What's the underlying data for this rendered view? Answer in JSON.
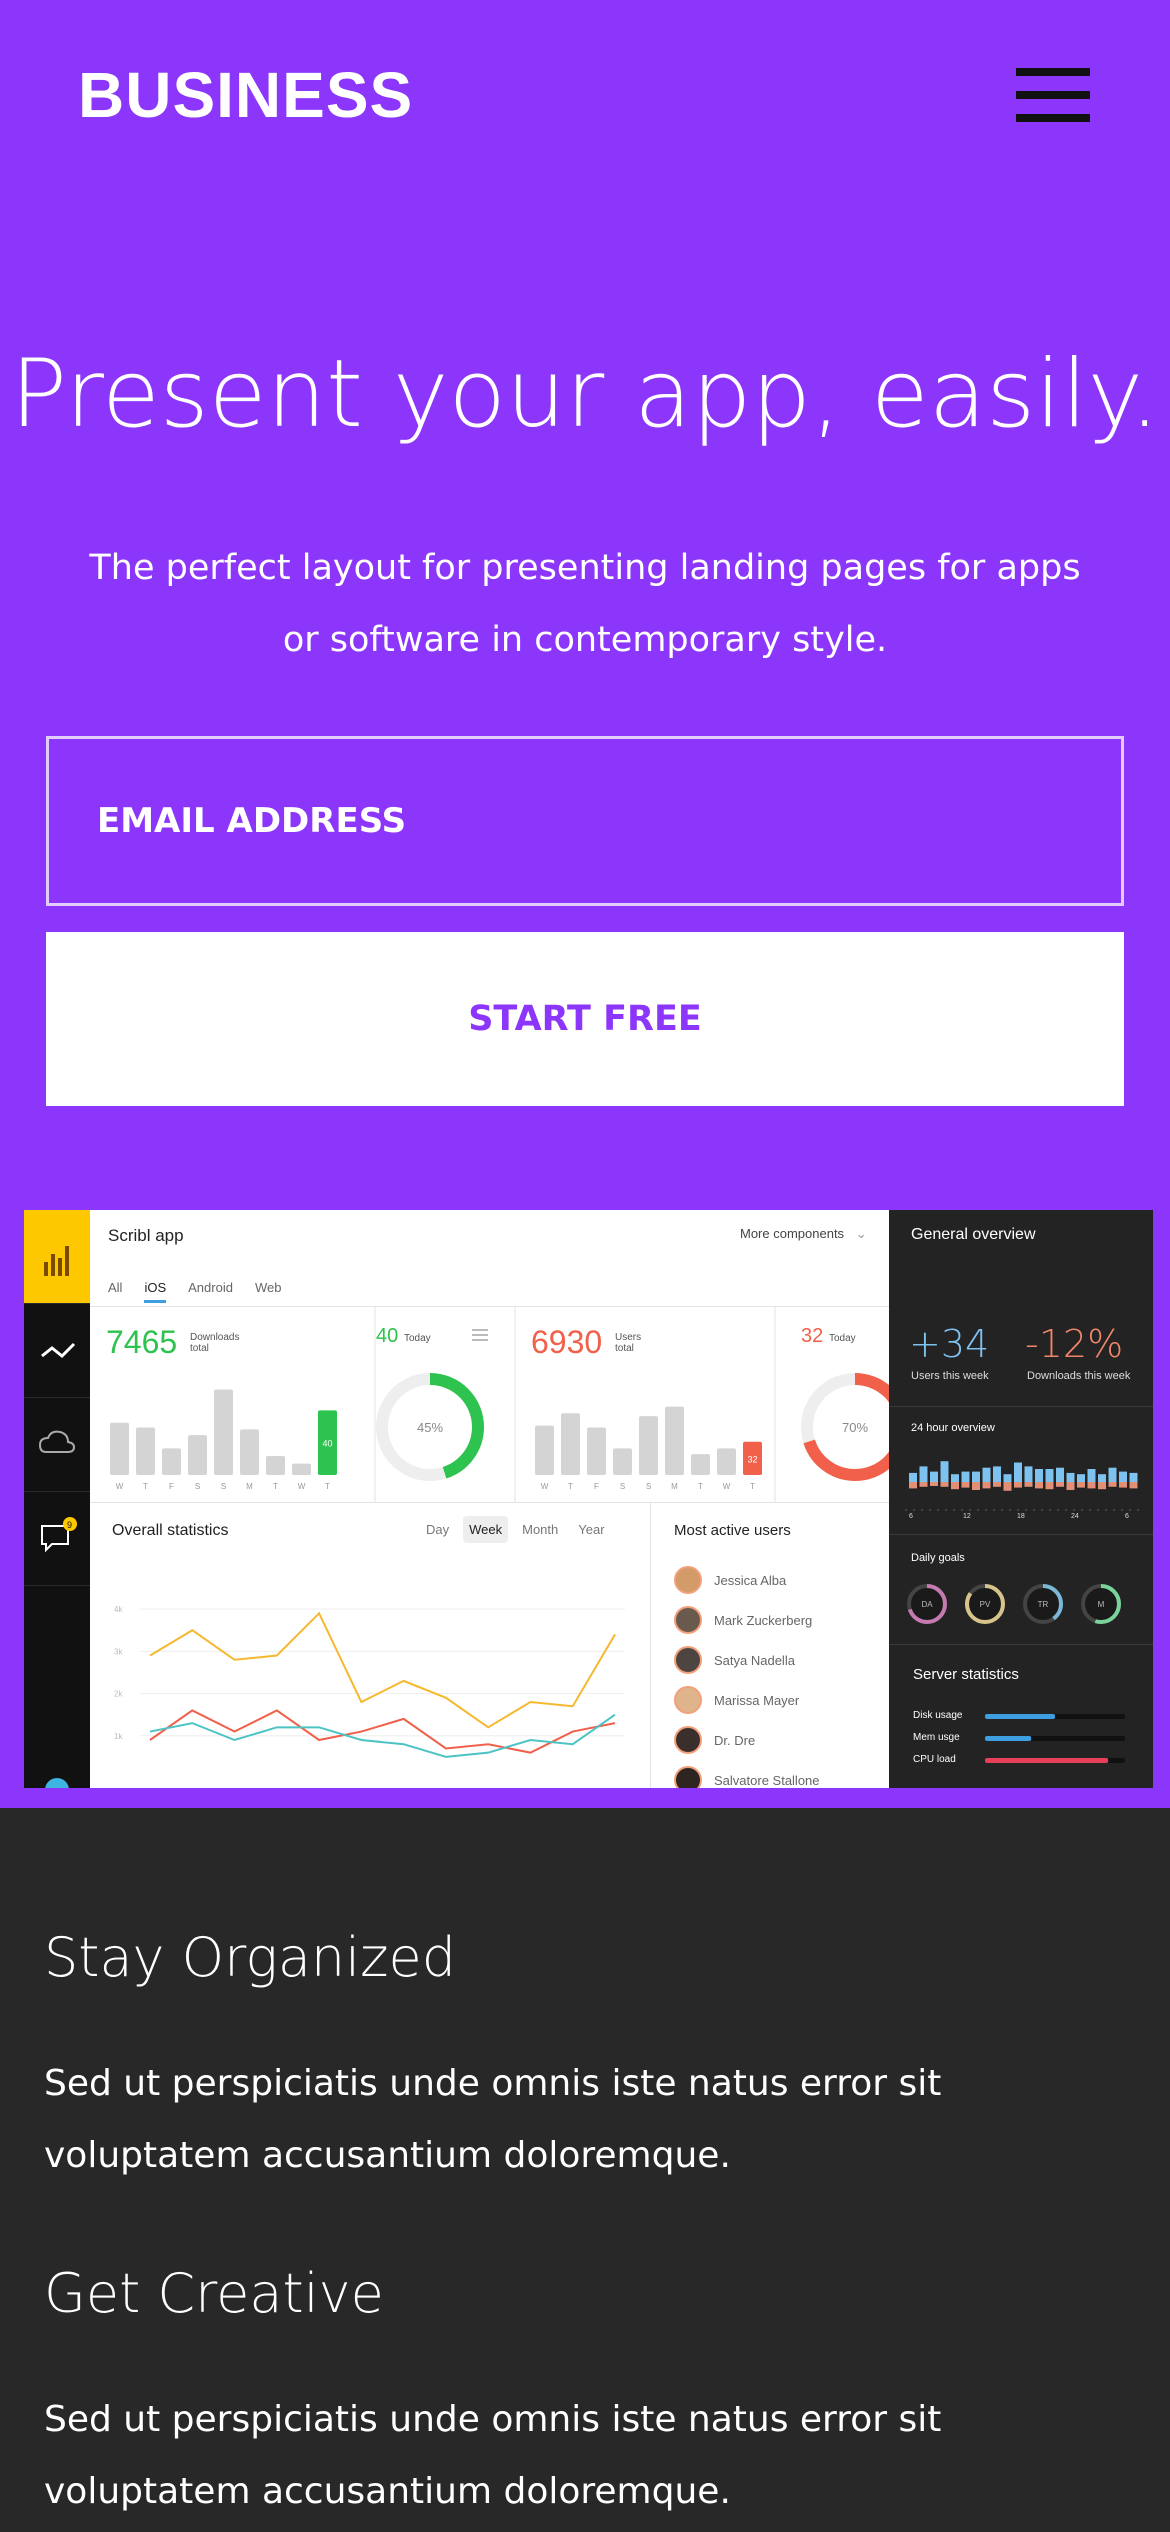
{
  "header": {
    "logo": "BUSINESS",
    "menu_icon": "hamburger-icon"
  },
  "hero": {
    "headline": "Present your app, easily.",
    "subtext": "The perfect layout for presenting landing pages for apps or software in contemporary style.",
    "email_placeholder": "EMAIL ADDRESS",
    "cta_label": "START FREE"
  },
  "colors": {
    "brand": "#8c36fb",
    "dark_section": "#282828",
    "accent_green": "#2ec24e",
    "accent_red": "#f0604a",
    "accent_yellow": "#f5b82e",
    "accent_teal": "#4cc3c4"
  },
  "dashboard": {
    "app_title": "Scribl app",
    "more_components": "More components",
    "platform_tabs": [
      "All",
      "iOS",
      "Android",
      "Web"
    ],
    "active_tab": "iOS",
    "downloads": {
      "total": "7465",
      "label1": "Downloads",
      "label2": "total",
      "today": "40",
      "today_label": "Today",
      "percent": 45,
      "percent_label": "45%"
    },
    "users": {
      "total": "6930",
      "label1": "Users",
      "label2": "total",
      "today": "32",
      "today_label": "Today",
      "percent": 70,
      "percent_label": "70%"
    },
    "weekday_labels": [
      "W",
      "T",
      "F",
      "S",
      "S",
      "M",
      "T",
      "W",
      "T"
    ],
    "downloads_bars": [
      0.55,
      0.5,
      0.28,
      0.42,
      0.9,
      0.48,
      0.2,
      0.12,
      0.68
    ],
    "users_bars": [
      0.52,
      0.65,
      0.5,
      0.28,
      0.62,
      0.72,
      0.22,
      0.28,
      0.35
    ],
    "overall_statistics": {
      "title": "Overall statistics",
      "ranges": [
        "Day",
        "Week",
        "Month",
        "Year"
      ],
      "active_range": "Week",
      "y_ticks": [
        "4k",
        "3k",
        "2k",
        "1k"
      ],
      "series": [
        {
          "color": "#f5b82e",
          "values": [
            2.9,
            3.5,
            2.8,
            2.9,
            3.9,
            1.8,
            2.3,
            1.9,
            1.2,
            1.8,
            1.7,
            3.4
          ]
        },
        {
          "color": "#f0604a",
          "values": [
            0.9,
            1.6,
            1.1,
            1.6,
            0.9,
            1.1,
            1.4,
            0.7,
            0.8,
            0.6,
            1.1,
            1.3
          ]
        },
        {
          "color": "#4cc3c4",
          "values": [
            1.1,
            1.3,
            0.9,
            1.2,
            1.2,
            0.9,
            0.8,
            0.5,
            0.6,
            0.9,
            0.8,
            1.5
          ]
        }
      ]
    },
    "most_active_users": {
      "title": "Most active users",
      "users": [
        {
          "name": "Jessica Alba",
          "color": "#d39a6a"
        },
        {
          "name": "Mark Zuckerberg",
          "color": "#6a5a4e"
        },
        {
          "name": "Satya Nadella",
          "color": "#4e4540"
        },
        {
          "name": "Marissa Mayer",
          "color": "#e0b48a"
        },
        {
          "name": "Dr. Dre",
          "color": "#3a2f2a"
        },
        {
          "name": "Salvatore Stallone",
          "color": "#2e2420"
        }
      ]
    },
    "general_overview": {
      "title": "General overview",
      "users_value": "+34",
      "users_label": "Users this week",
      "downloads_value": "-12%",
      "downloads_label": "Downloads this week",
      "hour_title": "24 hour overview",
      "hour_ticks": [
        "6",
        "12",
        "18",
        "24",
        "6"
      ],
      "hour_up": [
        0.35,
        0.6,
        0.4,
        0.8,
        0.3,
        0.4,
        0.4,
        0.55,
        0.6,
        0.3,
        0.75,
        0.6,
        0.5,
        0.5,
        0.55,
        0.35,
        0.3,
        0.5,
        0.3,
        0.55,
        0.4,
        0.35
      ],
      "hour_down": [
        0.4,
        0.3,
        0.25,
        0.3,
        0.45,
        0.35,
        0.5,
        0.4,
        0.3,
        0.55,
        0.35,
        0.3,
        0.4,
        0.45,
        0.3,
        0.5,
        0.35,
        0.4,
        0.45,
        0.3,
        0.35,
        0.4
      ],
      "goals_title": "Daily goals",
      "goals": [
        {
          "label": "DA",
          "color": "#c77ab0",
          "value": 0.7
        },
        {
          "label": "PV",
          "color": "#d7c48a",
          "value": 0.85
        },
        {
          "label": "TR",
          "color": "#7bb8d8",
          "value": 0.4
        },
        {
          "label": "M",
          "color": "#7ad49a",
          "value": 0.55
        }
      ],
      "server_title": "Server statistics",
      "server": [
        {
          "label": "Disk usage",
          "color": "#3d9fe0",
          "value": 0.5
        },
        {
          "label": "Mem usge",
          "color": "#3d9fe0",
          "value": 0.33
        },
        {
          "label": "CPU load",
          "color": "#e8405a",
          "value": 0.88
        }
      ]
    }
  },
  "features": [
    {
      "title": "Stay Organized",
      "text": "Sed ut perspiciatis unde omnis iste natus error sit voluptatem accusantium doloremque."
    },
    {
      "title": "Get Creative",
      "text": "Sed ut perspiciatis unde omnis iste natus error sit voluptatem accusantium doloremque."
    }
  ]
}
